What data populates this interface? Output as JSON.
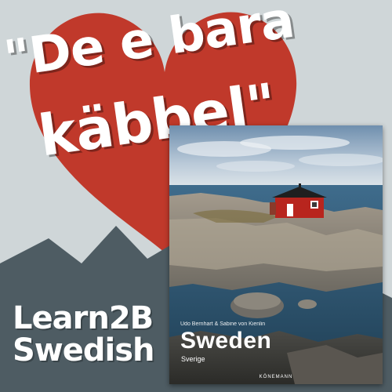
{
  "headline": {
    "line1": "\"De e bara",
    "line2": "käbbel\""
  },
  "brand": {
    "line1": "Learn2B",
    "line2": "Swedish"
  },
  "book": {
    "authors": "Udo Bernhart & Sabine von Kienlin",
    "title": "Sweden",
    "subtitle": "Sverige",
    "publisher": "KÖNEMANN"
  },
  "colors": {
    "background": "#cfd6d8",
    "heart": "#c0392b",
    "mountains": "#4e5c63",
    "text": "#ffffff"
  },
  "icons": {
    "heart": "heart-icon",
    "mountains": "mountain-range"
  }
}
